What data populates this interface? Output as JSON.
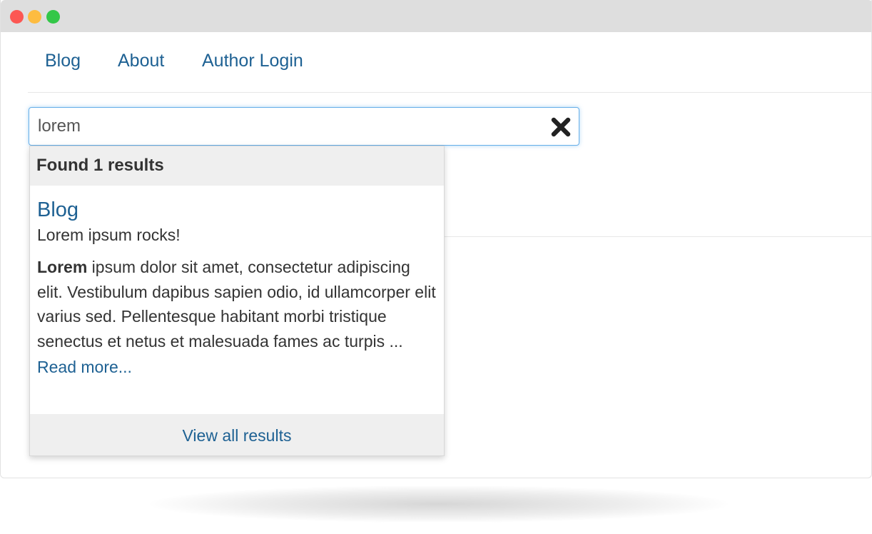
{
  "window": {
    "controls": [
      "close",
      "minimize",
      "maximize"
    ]
  },
  "nav": {
    "items": [
      {
        "label": "Blog"
      },
      {
        "label": "About"
      },
      {
        "label": "Author Login"
      }
    ]
  },
  "search": {
    "value": "lorem",
    "clear_icon": "close-x-icon"
  },
  "results": {
    "header": "Found 1 results",
    "items": [
      {
        "title": "Blog",
        "subtitle": "Lorem ipsum rocks!",
        "excerpt_highlight": "Lorem",
        "excerpt_rest": " ipsum dolor sit amet, consectetur adipiscing elit. Vestibulum dapibus sapien odio, id ullamcorper elit varius sed. Pellentesque habitant morbi tristique senectus et netus et malesuada fames ac turpis ...",
        "read_more": "Read more..."
      }
    ],
    "footer_link": "View all results"
  },
  "colors": {
    "link": "#1e6193",
    "focus_border": "#66afe9",
    "header_bg": "#efefef",
    "close_dot": "#fc5753",
    "minimize_dot": "#fdbc40",
    "maximize_dot": "#33c748"
  }
}
